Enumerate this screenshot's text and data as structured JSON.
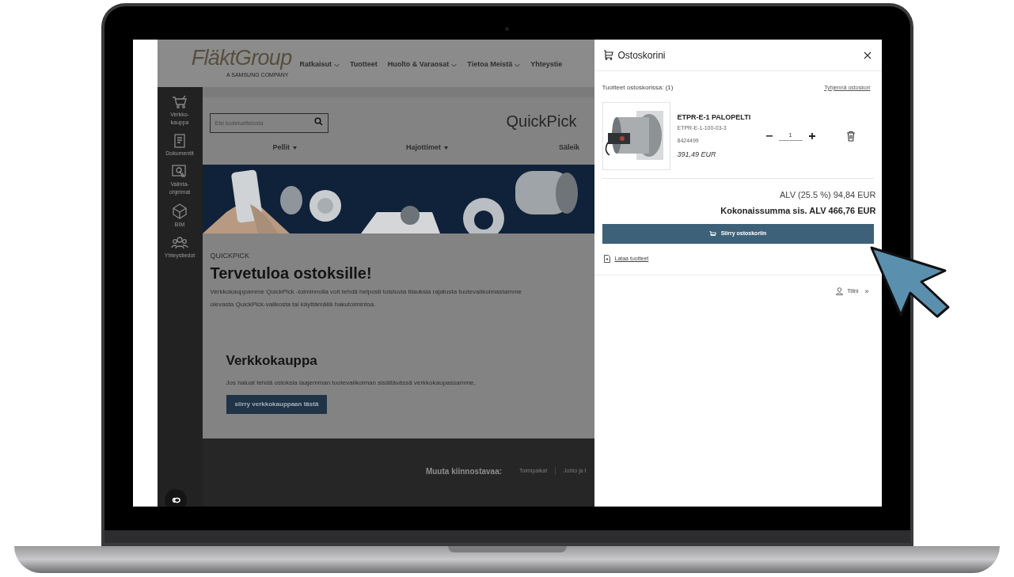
{
  "site": {
    "logo": "**Fläkt**Group",
    "logo_tagline": "A SAMSUNG COMPANY",
    "nav": [
      {
        "label": "Ratkaisut",
        "dropdown": true
      },
      {
        "label": "Tuotteet",
        "dropdown": false
      },
      {
        "label": "Huolto & Varaosat",
        "dropdown": true
      },
      {
        "label": "Tietoa Meistä",
        "dropdown": true
      },
      {
        "label": "Yhteystie",
        "dropdown": false
      }
    ],
    "sidebar": [
      {
        "kind": "cart",
        "label": "Verkko-kauppa"
      },
      {
        "kind": "document",
        "label": "Dokumentit"
      },
      {
        "kind": "touch",
        "label": "Valinta-ohjelmat"
      },
      {
        "kind": "cube",
        "label": "BIM"
      },
      {
        "kind": "people",
        "label": "Yhteystiedot"
      }
    ]
  },
  "page": {
    "search_placeholder": "Etsi tuoteluettelosta",
    "title": "QuickPick",
    "categories": [
      {
        "label": "Pellit",
        "dropdown": true
      },
      {
        "label": "Hajottimet",
        "dropdown": true
      },
      {
        "label": "Säleik",
        "dropdown": false
      }
    ],
    "eyebrow": "QUICKPICK",
    "heading": "Tervetuloa ostoksille!",
    "intro_lines": [
      "Verkkokauppamme QuickPick -toiminnolla voit tehdä helposti toistuvia tilauksia rajatusta tuotevalikoimastamme",
      "olevasta QuickPick-valikosta tai käyttämällä hakutoimintoa."
    ],
    "shop_heading": "Verkkokauppa",
    "shop_text": "Jos haluat tehdä ostoksia laajemman tuotevalikoiman sisältävässä verkkokaupassamme,",
    "shop_button": "siirry verkkokauppaan tästä"
  },
  "footer": {
    "label": "Muuta kiinnostavaa:",
    "links": [
      "Toimipaikat",
      "Johto ja t"
    ]
  },
  "cart": {
    "title": "Ostoskorini",
    "count_label": "Tuotteet ostoskorissa: (1)",
    "clear_link": "Tyhjennä ostoskori",
    "items": [
      {
        "name": "ETPR-E-1 PALOPELTI",
        "code": "ETPR-E-1-100-03-3",
        "number": "8424499",
        "price": "391,49 EUR",
        "quantity": "1"
      }
    ],
    "vat": "ALV (25.5 %) 94,84 EUR",
    "total": "Kokonaissumma sis. ALV 466,76 EUR",
    "checkout_button": "Siirry ostoskoriin",
    "download_link": "Lataa tuotteet",
    "account_link": "Tilini",
    "account_chevron": "»"
  }
}
